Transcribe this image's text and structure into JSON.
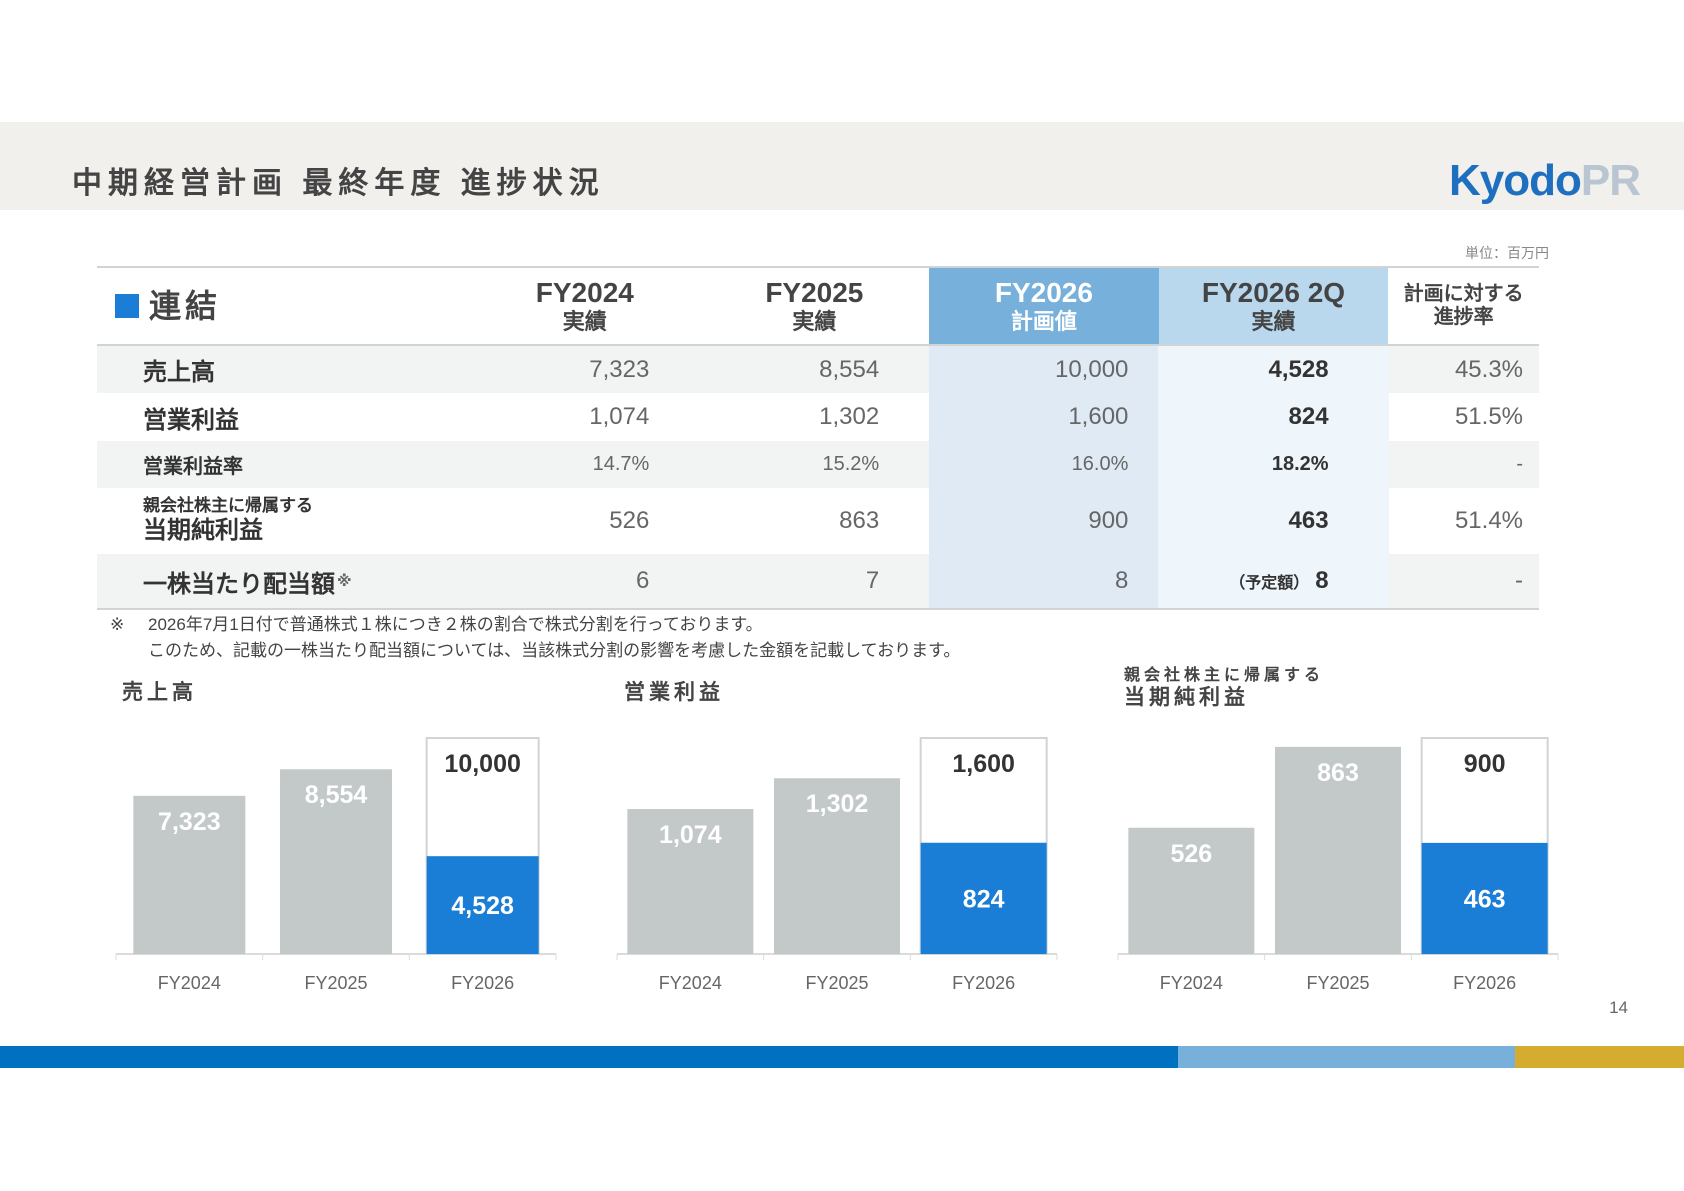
{
  "header": {
    "title": "中期経営計画 最終年度 進捗状況",
    "logo_main": "Kyodo",
    "logo_suffix": "PR"
  },
  "unit": "単位：百万円",
  "table": {
    "section": "連結",
    "columns": [
      {
        "line1": "FY2024",
        "line2": "実績"
      },
      {
        "line1": "FY2025",
        "line2": "実績"
      },
      {
        "line1": "FY2026",
        "line2": "計画値"
      },
      {
        "line1": "FY2026 2Q",
        "line2": "実績"
      },
      {
        "line1": "計画に対する",
        "line2": "進捗率"
      }
    ],
    "rows": [
      {
        "label": "売上高",
        "values": [
          "7,323",
          "8,554",
          "10,000",
          "4,528",
          "45.3%"
        ]
      },
      {
        "label": "営業利益",
        "values": [
          "1,074",
          "1,302",
          "1,600",
          "824",
          "51.5%"
        ]
      },
      {
        "label": "営業利益率",
        "values": [
          "14.7%",
          "15.2%",
          "16.0%",
          "18.2%",
          "-"
        ]
      },
      {
        "label_line1": "親会社株主に帰属する",
        "label_line2": "当期純利益",
        "values": [
          "526",
          "863",
          "900",
          "463",
          "51.4%"
        ]
      },
      {
        "label": "一株当たり配当額",
        "label_mark": "※",
        "prefix": "（予定額）",
        "values": [
          "6",
          "7",
          "8",
          "8",
          "-"
        ]
      }
    ]
  },
  "note": {
    "mark": "※",
    "line1": "2026年7月1日付で普通株式１株につき２株の割合で株式分割を行っております。",
    "line2": "このため、記載の一株当たり配当額については、当該株式分割の影響を考慮した金額を記載しております。"
  },
  "colors": {
    "actual": "#1a7dd6",
    "past": "#c3c9c9",
    "plan_border": "#d0d4d6",
    "band1": "#0070c0",
    "band2": "#76b0db",
    "band3": "#d4ac2f"
  },
  "chart_data": [
    {
      "type": "bar",
      "title": "売上高",
      "categories": [
        "FY2024",
        "FY2025",
        "FY2026"
      ],
      "values": [
        7323,
        8554,
        4528
      ],
      "plan": 10000,
      "labels": [
        "7,323",
        "8,554",
        "4,528"
      ],
      "plan_label": "10,000"
    },
    {
      "type": "bar",
      "title": "営業利益",
      "categories": [
        "FY2024",
        "FY2025",
        "FY2026"
      ],
      "values": [
        1074,
        1302,
        824
      ],
      "plan": 1600,
      "labels": [
        "1,074",
        "1,302",
        "824"
      ],
      "plan_label": "1,600"
    },
    {
      "type": "bar",
      "title_line1": "親会社株主に帰属する",
      "title": "当期純利益",
      "categories": [
        "FY2024",
        "FY2025",
        "FY2026"
      ],
      "values": [
        526,
        863,
        463
      ],
      "plan": 900,
      "labels": [
        "526",
        "863",
        "463"
      ],
      "plan_label": "900"
    }
  ],
  "page_number": "14"
}
